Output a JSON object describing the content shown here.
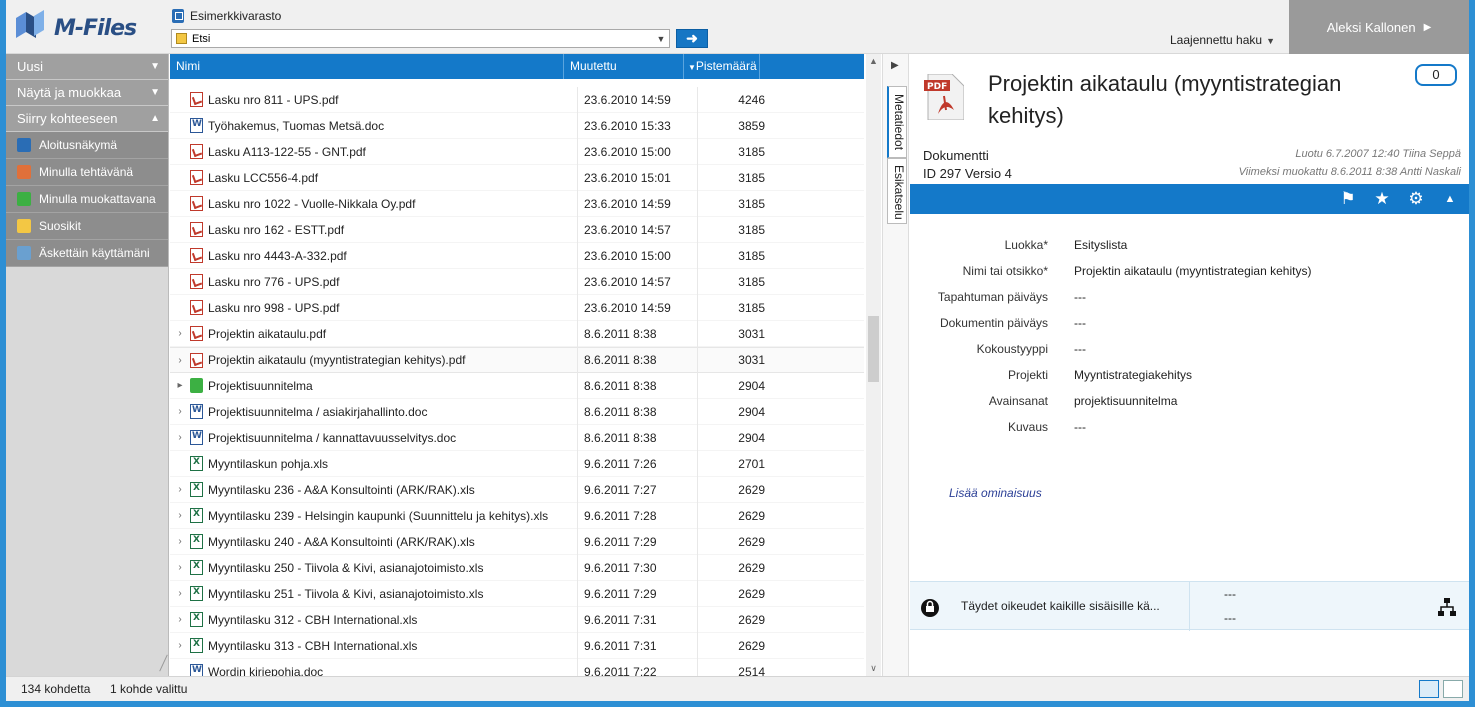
{
  "header": {
    "logo_text": "M-Files",
    "vault_name": "Esimerkkivarasto",
    "search_value": "Etsi",
    "advanced_search": "Laajennettu haku",
    "user_name": "Aleksi Kallonen"
  },
  "sidebar": {
    "sections": [
      {
        "label": "Uusi"
      },
      {
        "label": "Näytä ja muokkaa"
      },
      {
        "label": "Siirry kohteeseen"
      }
    ],
    "items": [
      {
        "label": "Aloitusnäkymä",
        "color": "#2a6db5"
      },
      {
        "label": "Minulla tehtävänä",
        "color": "#e0703a"
      },
      {
        "label": "Minulla muokattavana",
        "color": "#3cb043"
      },
      {
        "label": "Suosikit",
        "color": "#f3c744"
      },
      {
        "label": "Äskettäin käyttämäni",
        "color": "#6aa0d0"
      }
    ]
  },
  "list": {
    "columns": {
      "name": "Nimi",
      "modified": "Muutettu",
      "score": "Pistemäärä"
    },
    "rows": [
      {
        "exp": "",
        "icon": "pdf",
        "name": "Lasku nro 811 - UPS.pdf",
        "modified": "23.6.2010 14:59",
        "score": "4246"
      },
      {
        "exp": "",
        "icon": "doc",
        "name": "Työhakemus, Tuomas Metsä.doc",
        "modified": "23.6.2010 15:33",
        "score": "3859"
      },
      {
        "exp": "",
        "icon": "pdf",
        "name": "Lasku A113-122-55 - GNT.pdf",
        "modified": "23.6.2010 15:00",
        "score": "3185"
      },
      {
        "exp": "",
        "icon": "pdf",
        "name": "Lasku LCC556-4.pdf",
        "modified": "23.6.2010 15:01",
        "score": "3185"
      },
      {
        "exp": "",
        "icon": "pdf",
        "name": "Lasku nro 1022 - Vuolle-Nikkala Oy.pdf",
        "modified": "23.6.2010 14:59",
        "score": "3185"
      },
      {
        "exp": "",
        "icon": "pdf",
        "name": "Lasku nro 162 - ESTT.pdf",
        "modified": "23.6.2010 14:57",
        "score": "3185"
      },
      {
        "exp": "",
        "icon": "pdf",
        "name": "Lasku nro 4443-A-332.pdf",
        "modified": "23.6.2010 15:00",
        "score": "3185"
      },
      {
        "exp": "",
        "icon": "pdf",
        "name": "Lasku nro 776 - UPS.pdf",
        "modified": "23.6.2010 14:57",
        "score": "3185"
      },
      {
        "exp": "",
        "icon": "pdf",
        "name": "Lasku nro 998 - UPS.pdf",
        "modified": "23.6.2010 14:59",
        "score": "3185"
      },
      {
        "exp": "›",
        "icon": "pdf",
        "name": "Projektin aikataulu.pdf",
        "modified": "8.6.2011 8:38",
        "score": "3031"
      },
      {
        "exp": "›",
        "icon": "pdf",
        "name": "Projektin aikataulu (myyntistrategian kehitys).pdf",
        "modified": "8.6.2011 8:38",
        "score": "3031",
        "selected": true
      },
      {
        "exp": "▸",
        "icon": "proj",
        "name": "Projektisuunnitelma",
        "modified": "8.6.2011 8:38",
        "score": "2904"
      },
      {
        "exp": "›",
        "icon": "doc",
        "name": "Projektisuunnitelma / asiakirjahallinto.doc",
        "modified": "8.6.2011 8:38",
        "score": "2904"
      },
      {
        "exp": "›",
        "icon": "doc",
        "name": "Projektisuunnitelma / kannattavuusselvitys.doc",
        "modified": "8.6.2011 8:38",
        "score": "2904"
      },
      {
        "exp": "",
        "icon": "xls",
        "name": "Myyntilaskun pohja.xls",
        "modified": "9.6.2011 7:26",
        "score": "2701"
      },
      {
        "exp": "›",
        "icon": "xls",
        "name": "Myyntilasku 236 - A&A Konsultointi (ARK/RAK).xls",
        "modified": "9.6.2011 7:27",
        "score": "2629"
      },
      {
        "exp": "›",
        "icon": "xls",
        "name": "Myyntilasku 239 - Helsingin kaupunki (Suunnittelu ja kehitys).xls",
        "modified": "9.6.2011 7:28",
        "score": "2629"
      },
      {
        "exp": "›",
        "icon": "xls",
        "name": "Myyntilasku 240 - A&A Konsultointi (ARK/RAK).xls",
        "modified": "9.6.2011 7:29",
        "score": "2629"
      },
      {
        "exp": "›",
        "icon": "xls",
        "name": "Myyntilasku 250 - Tiivola & Kivi, asianajotoimisto.xls",
        "modified": "9.6.2011 7:30",
        "score": "2629"
      },
      {
        "exp": "›",
        "icon": "xls",
        "name": "Myyntilasku 251 - Tiivola & Kivi, asianajotoimisto.xls",
        "modified": "9.6.2011 7:29",
        "score": "2629"
      },
      {
        "exp": "›",
        "icon": "xls",
        "name": "Myyntilasku 312 - CBH International.xls",
        "modified": "9.6.2011 7:31",
        "score": "2629"
      },
      {
        "exp": "›",
        "icon": "xls",
        "name": "Myyntilasku 313 - CBH International.xls",
        "modified": "9.6.2011 7:31",
        "score": "2629"
      },
      {
        "exp": "",
        "icon": "doc",
        "name": "Wordin kirjepohja.doc",
        "modified": "9.6.2011 7:22",
        "score": "2514"
      }
    ]
  },
  "tabs": {
    "metadata": "Metatiedot",
    "preview": "Esikatselu"
  },
  "meta": {
    "title": "Projektin aikataulu (myyntistrategian kehitys)",
    "comments_count": "0",
    "object_type": "Dokumentti",
    "object_id": "ID 297  Versio 4",
    "created": "Luotu 6.7.2007 12:40 Tiina Seppä",
    "modified": "Viimeksi muokattu 8.6.2011 8:38 Antti Naskali",
    "properties": [
      {
        "label": "Luokka*",
        "value": "Esityslista"
      },
      {
        "label": "Nimi tai otsikko*",
        "value": "Projektin aikataulu (myyntistrategian kehitys)"
      },
      {
        "label": "Tapahtuman päiväys",
        "value": "---"
      },
      {
        "label": "Dokumentin päiväys",
        "value": "---"
      },
      {
        "label": "Kokoustyyppi",
        "value": "---"
      },
      {
        "label": "Projekti",
        "value": "Myyntistrategiakehitys"
      },
      {
        "label": "Avainsanat",
        "value": "projektisuunnitelma"
      },
      {
        "label": "Kuvaus",
        "value": "---"
      }
    ],
    "add_property": "Lisää ominaisuus",
    "permissions": "Täydet oikeudet kaikille sisäisille kä...",
    "workflow": "---",
    "state": "---"
  },
  "status": {
    "count": "134 kohdetta",
    "selected": "1 kohde valittu"
  }
}
